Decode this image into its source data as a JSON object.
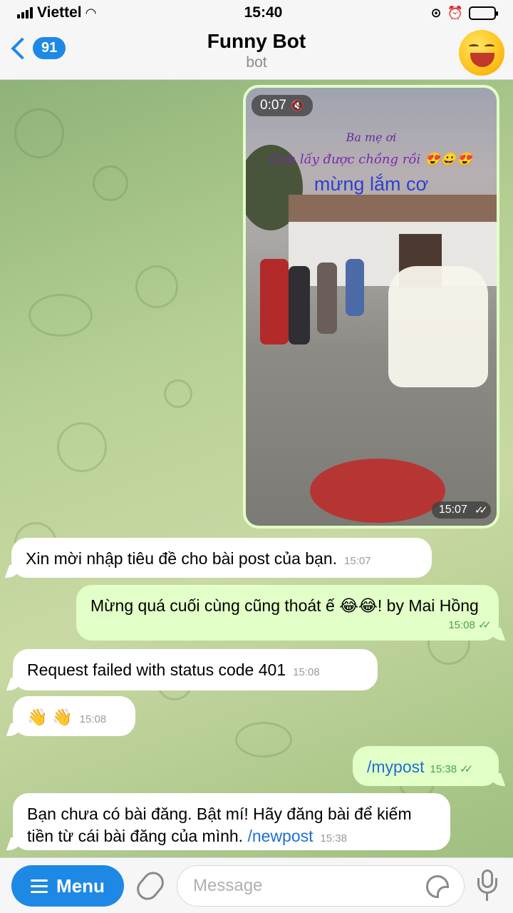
{
  "status_bar": {
    "carrier": "Viettel",
    "time": "15:40"
  },
  "header": {
    "unread_count": "91",
    "title": "Funny Bot",
    "subtitle": "bot"
  },
  "video": {
    "duration": "0:07",
    "overlay_line1": "Ba mẹ ơi",
    "overlay_line2": "Con lấy được chồng rồi 😍😀😍",
    "overlay_line3": "mừng lắm cơ",
    "time": "15:07"
  },
  "messages": [
    {
      "direction": "in",
      "text": "Xin mời nhập tiêu đề cho bài post của bạn.",
      "time": "15:07"
    },
    {
      "direction": "out",
      "text": "Mừng quá cuối cùng cũng thoát ế 😂😂! by Mai Hồng",
      "time": "15:08"
    },
    {
      "direction": "in",
      "text": "Request failed with status code 401",
      "time": "15:08"
    },
    {
      "direction": "in",
      "text": "👋 👋",
      "time": "15:08"
    },
    {
      "direction": "out",
      "text": "/mypost",
      "time": "15:38"
    },
    {
      "direction": "in",
      "text": "Bạn chưa có bài đăng. Bật mí! Hãy đăng bài để kiếm tiền từ cái bài đăng của mình.",
      "link": "/newpost",
      "time": "15:38"
    }
  ],
  "input_bar": {
    "menu_label": "Menu",
    "placeholder": "Message"
  }
}
